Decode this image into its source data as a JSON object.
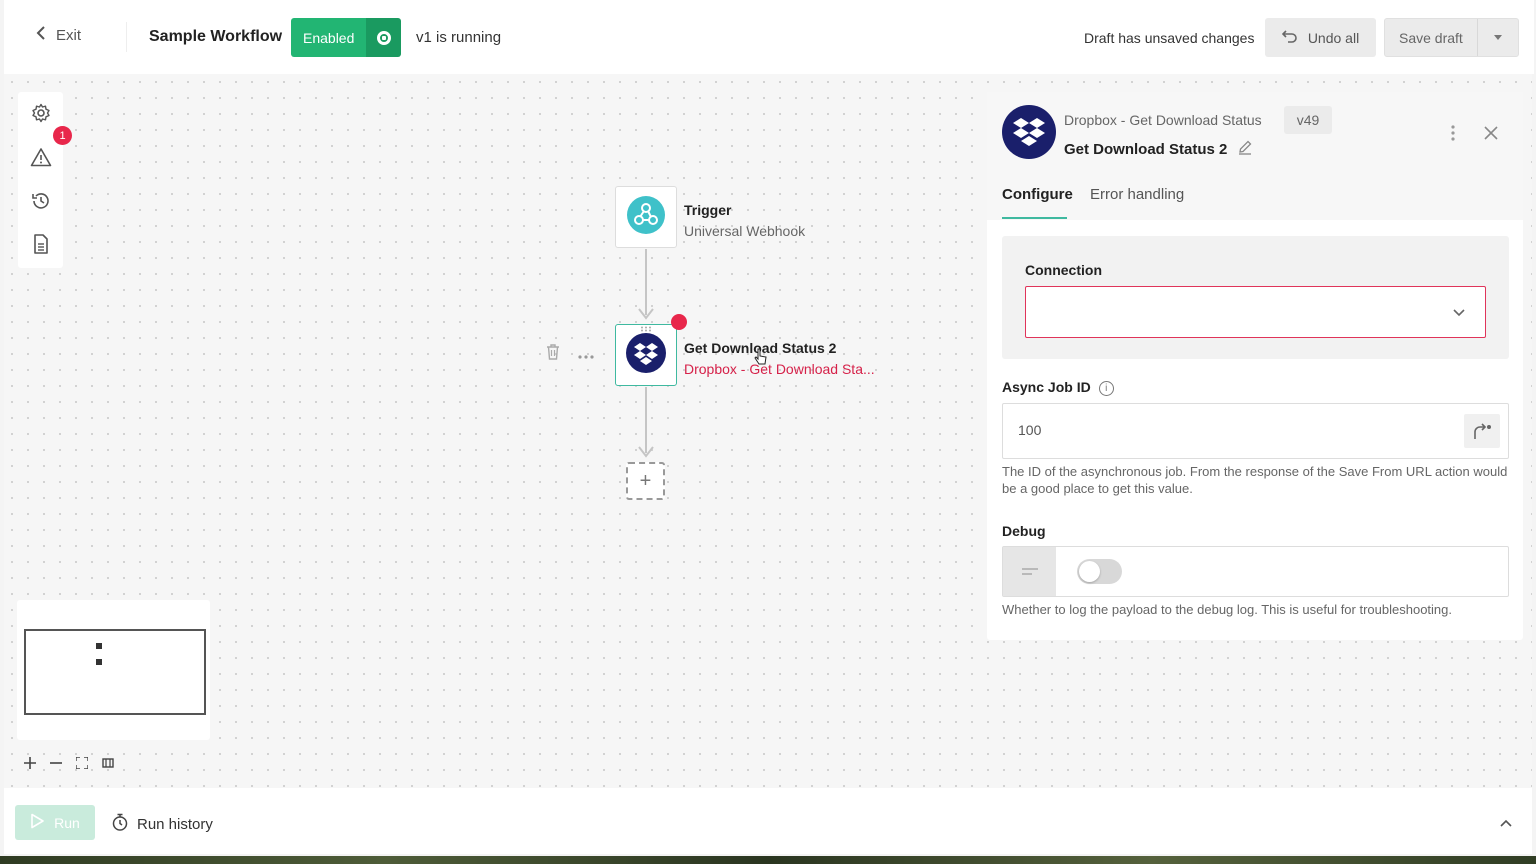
{
  "header": {
    "exit_label": "Exit",
    "workflow_title": "Sample Workflow",
    "enabled_label": "Enabled",
    "run_status": "v1 is running",
    "draft_message": "Draft has unsaved changes",
    "undo_label": "Undo all",
    "save_label": "Save draft"
  },
  "sidebar_tools": [
    {
      "icon": "gear-icon"
    },
    {
      "icon": "warning-icon",
      "badge": "1"
    },
    {
      "icon": "history-icon"
    },
    {
      "icon": "document-icon"
    }
  ],
  "canvas": {
    "trigger_node": {
      "title": "Trigger",
      "subtitle": "Universal Webhook",
      "icon": "webhook-icon"
    },
    "action_node": {
      "title": "Get Download Status 2",
      "subtitle": "Dropbox - Get Download Sta...",
      "icon": "dropbox-icon",
      "has_error": true
    },
    "add_step_label": "+"
  },
  "panel": {
    "app_name": "Dropbox - Get Download Status",
    "version": "v49",
    "step_name": "Get Download Status 2",
    "tabs": [
      {
        "label": "Configure",
        "active": true
      },
      {
        "label": "Error handling",
        "active": false
      }
    ],
    "connection": {
      "label": "Connection",
      "value": ""
    },
    "async_job_id": {
      "label": "Async Job ID",
      "value": "100",
      "help": "The ID of the asynchronous job. From the response of the Save From URL action would be a good place to get this value."
    },
    "debug": {
      "label": "Debug",
      "enabled": false,
      "help": "Whether to log the payload to the debug log. This is useful for troubleshooting."
    }
  },
  "bottom_bar": {
    "run_label": "Run",
    "run_history_label": "Run history"
  },
  "colors": {
    "accent_green": "#22b573",
    "error_red": "#e8274b",
    "dropbox_navy": "#1a1f6b",
    "webhook_teal": "#3fc1c9"
  }
}
